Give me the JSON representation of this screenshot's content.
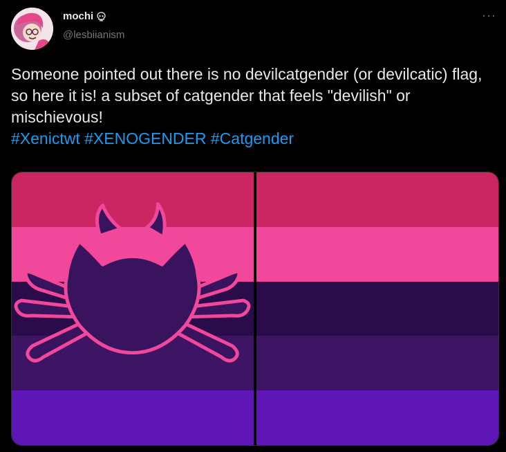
{
  "author": {
    "display_name": "mochi",
    "handle": "@lesbiianism",
    "badge_icon": "skull-icon"
  },
  "tweet": {
    "text": "Someone pointed out there is no devilcatgender (or devilcatic) flag, so here it is! a subset of catgender that feels \"devilish\" or mischievous!",
    "hashtags": [
      "#Xenictwt",
      "#XENOGENDER",
      "#Catgender"
    ]
  },
  "menu": {
    "icon": "more-icon",
    "label": "···"
  },
  "media": {
    "images": [
      {
        "name": "devilcat-flag-with-symbol",
        "symbol": "devil-cat-head-icon"
      },
      {
        "name": "devilcat-flag-plain"
      }
    ],
    "stripe_colors": [
      "#cb2562",
      "#f2489b",
      "#2a0c4a",
      "#3e1564",
      "#5e17b6"
    ],
    "symbol_fill": "#3a135e",
    "symbol_outline": "#f2489b"
  }
}
